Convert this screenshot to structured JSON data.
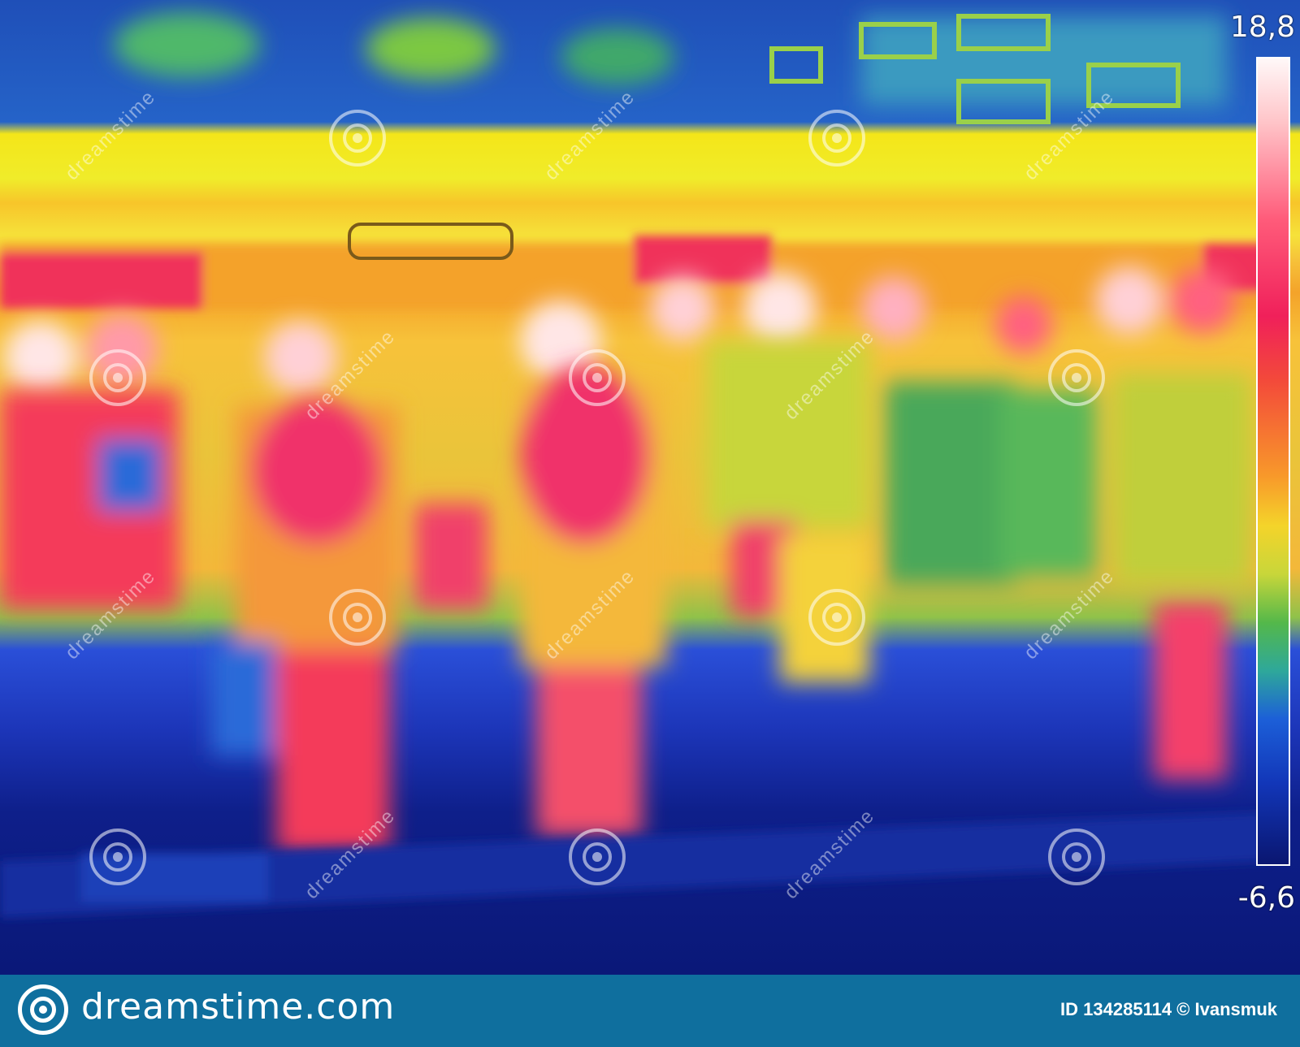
{
  "thermal_image": {
    "description_icon": "thermal-camera-view",
    "scale_max": "18,8",
    "scale_min": "-6,6",
    "palette": [
      "#fff8f8",
      "#ff5b7a",
      "#f0205a",
      "#f89a2a",
      "#f4d42a",
      "#54b84a",
      "#1c5fd8",
      "#0a1670"
    ]
  },
  "watermark": {
    "text": "dreamstime"
  },
  "footer": {
    "site": "dreamstime.com",
    "credit": "ID 134285114 © Ivansmuk",
    "background": "#0f6f9e"
  }
}
